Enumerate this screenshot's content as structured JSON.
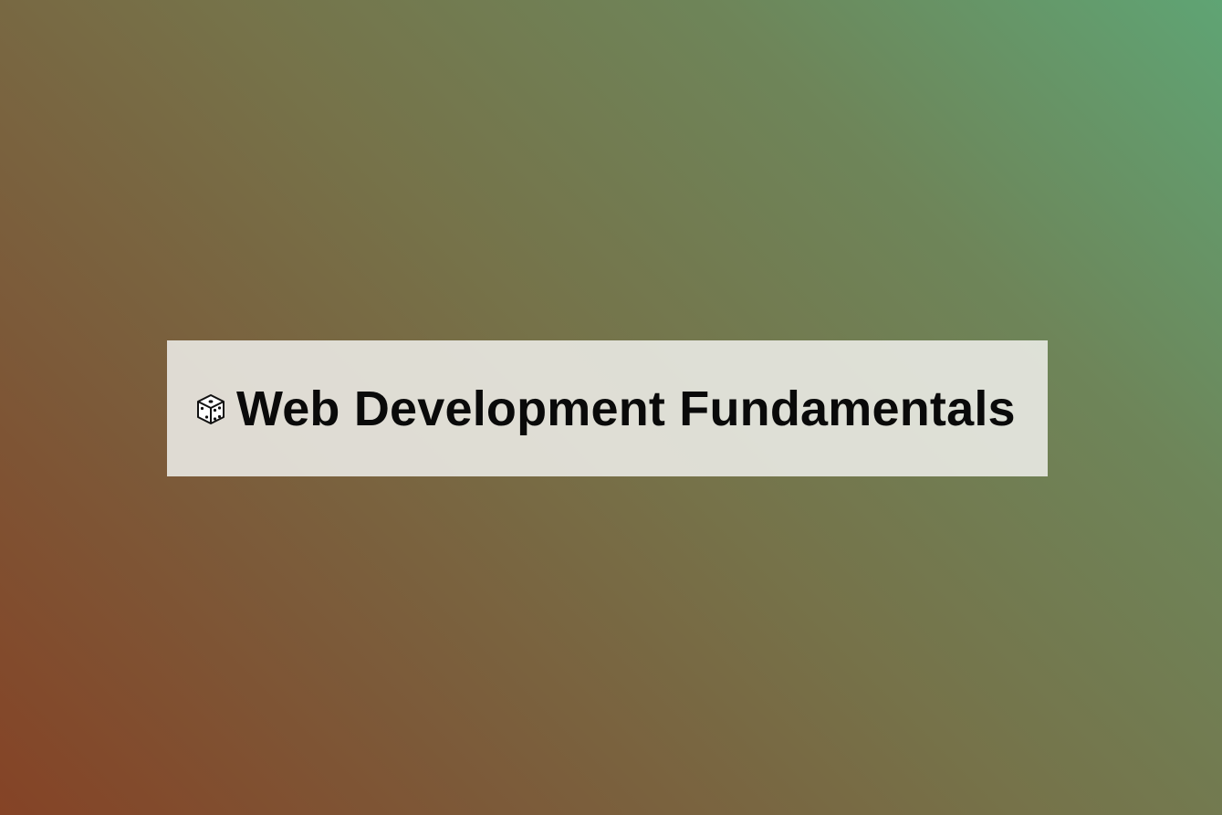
{
  "header": {
    "title": "Web Development Fundamentals",
    "icon": "dice-icon"
  },
  "colors": {
    "gradient_bottom_left": "#854326",
    "gradient_top_right": "#5fa474",
    "card_background": "#e8e8e2",
    "title_text": "#0a0a0a"
  }
}
